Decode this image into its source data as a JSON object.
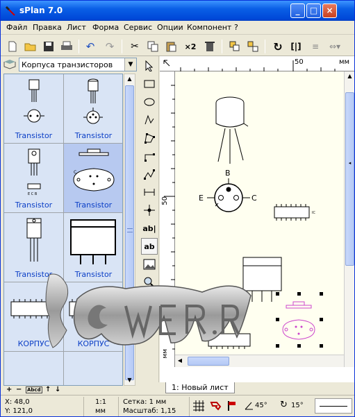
{
  "window": {
    "title": "sPlan 7.0"
  },
  "menu": [
    "Файл",
    "Правка",
    "Лист",
    "Форма",
    "Сервис",
    "Опции",
    "Компонент",
    "?"
  ],
  "toolbar": {
    "icons": [
      "new-file",
      "open-folder",
      "save",
      "print",
      "undo",
      "redo",
      "cut",
      "copy",
      "paste",
      "duplicate",
      "delete",
      "group",
      "ungroup",
      "rotate",
      "mirror-horizontal",
      "mirror-vertical",
      "align"
    ],
    "duplicate_label": "×2"
  },
  "library": {
    "selected": "Корпуса транзисторов",
    "components": [
      {
        "label": "Transistor"
      },
      {
        "label": "Transistor"
      },
      {
        "label": "Transistor"
      },
      {
        "label": "Transistor"
      },
      {
        "label": "Transistor"
      },
      {
        "label": "Transistor"
      },
      {
        "label": "КОРПУС"
      },
      {
        "label": "КОРПУС"
      }
    ],
    "bottom_buttons": [
      "+",
      "−",
      "Abcd",
      "↑",
      "↓"
    ]
  },
  "draw_tools": [
    "select",
    "rectangle",
    "ellipse",
    "freehand",
    "polygon",
    "line",
    "polyline",
    "dimension",
    "connector",
    "text",
    "text-frame",
    "image",
    "zoom",
    "grid-toggle"
  ],
  "draw_tool_labels": {
    "text": "ab|",
    "text_frame": "ab"
  },
  "canvas": {
    "ruler_h_label": "50",
    "ruler_unit": "мм",
    "ruler_v_label": "50",
    "ruler_v_unit": "мм",
    "pin_labels": {
      "b": "B",
      "e": "E",
      "c": "C"
    },
    "ic_label": "IC"
  },
  "sheet_tab": "1: Новый лист",
  "status": {
    "x": "X: 48,0",
    "y": "Y: 121,0",
    "scale_ratio": "1:1",
    "scale_unit": "мм",
    "grid": "Сетка: 1 мм",
    "zoom": "Масштаб:  1,15",
    "angle1": "45°",
    "angle2": "15°"
  },
  "colors": {
    "titlebar": "#0a5fe6",
    "label": "#0a3ec6",
    "selection": "#cc44cc"
  }
}
